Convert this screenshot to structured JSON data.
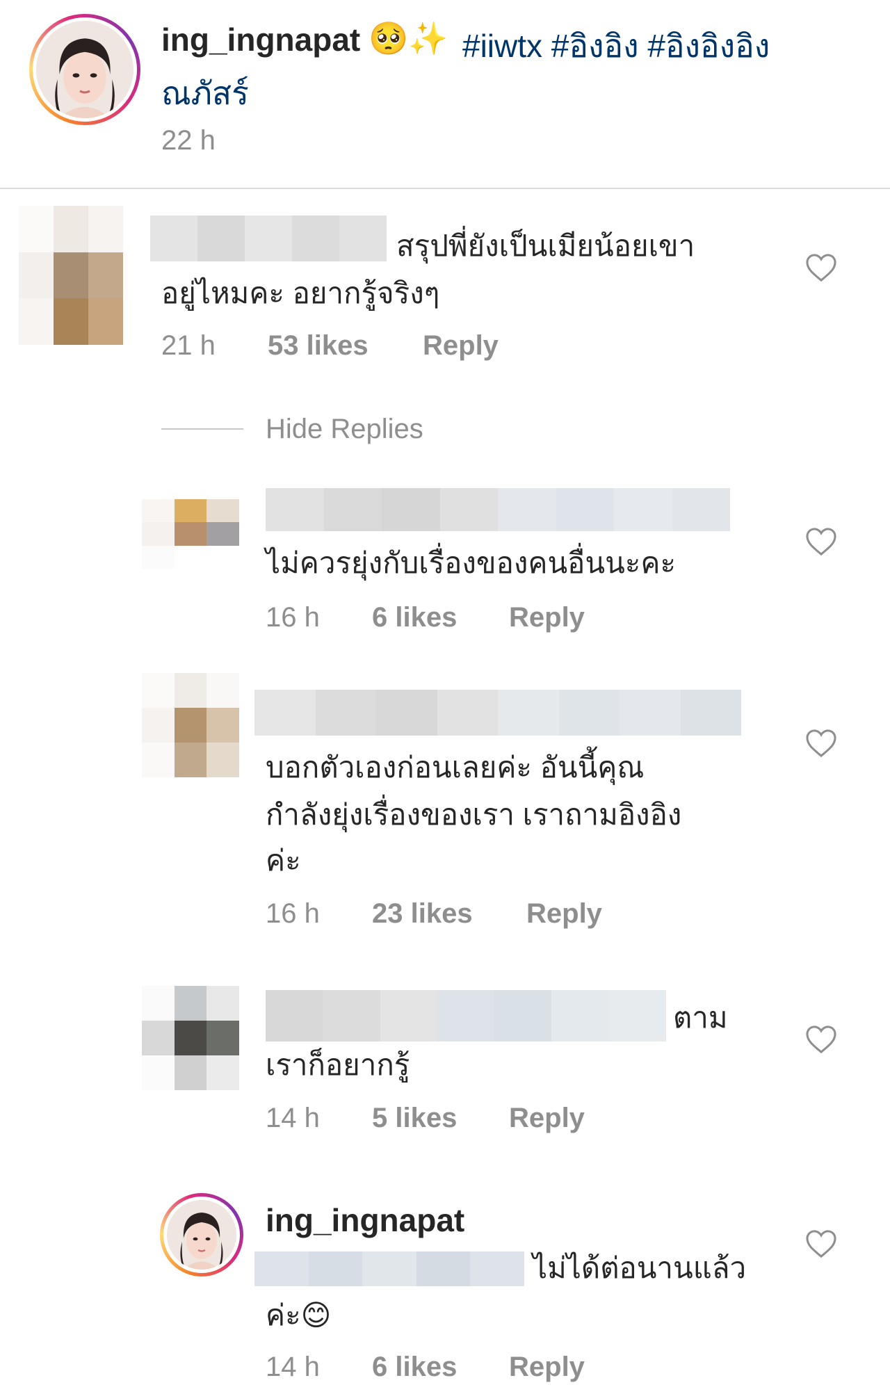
{
  "caption": {
    "username": "ing_ingnapat",
    "emoji": "🥺✨",
    "hashtags_line1": "#iiwtx #อิงอิง #อิงอิงอิง",
    "hashtags_line2": "ณภัสร์",
    "time": "22 h"
  },
  "comments": [
    {
      "text_line1": "สรุปพี่ยังเป็นเมียน้อยเขา",
      "text_line2": "อยู่ไหมคะ อยากรู้จริงๆ",
      "time": "21 h",
      "likes": "53 likes",
      "reply": "Reply"
    }
  ],
  "hide_replies": "Hide Replies",
  "replies": [
    {
      "text_line1": "ไม่ควรยุ่งกับเรื่องของคนอื่นนะคะ",
      "time": "16 h",
      "likes": "6 likes",
      "reply": "Reply"
    },
    {
      "text_line1": "บอกตัวเองก่อนเลยค่ะ อันนี้คุณ",
      "text_line2": "กำลังยุ่งเรื่องของเรา เราถามอิงอิง",
      "text_line3": "ค่ะ",
      "time": "16 h",
      "likes": "23 likes",
      "reply": "Reply"
    },
    {
      "text_inline": "ตาม",
      "text_line2": "เราก็อยากรู้",
      "time": "14 h",
      "likes": "5 likes",
      "reply": "Reply"
    },
    {
      "username": "ing_ingnapat",
      "text_inline": "ไม่ได้ต่อนานแล้ว",
      "text_line2": "ค่ะ😊",
      "time": "14 h",
      "likes": "6 likes",
      "reply": "Reply"
    }
  ],
  "colors": {
    "hashtag": "#003569",
    "meta_gray": "#8e8e8e",
    "text": "#262626",
    "divider": "#dbdbdb"
  },
  "icons": {
    "heart": "heart-outline-icon"
  }
}
